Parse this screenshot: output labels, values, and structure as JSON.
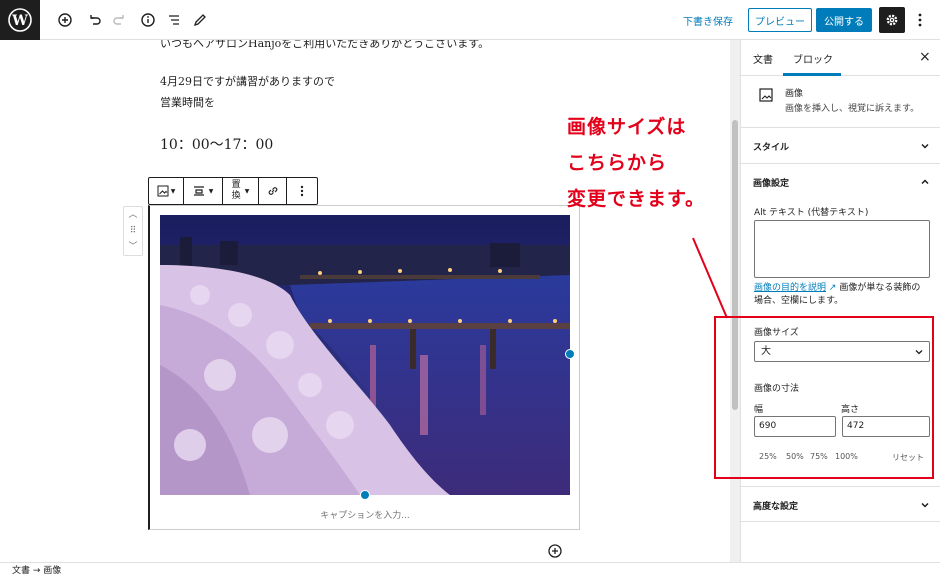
{
  "topbar": {
    "draft_save": "下書き保存",
    "preview": "プレビュー",
    "publish": "公開する",
    "icons": [
      "wordpress-logo",
      "add-block-icon",
      "undo-icon",
      "redo-icon",
      "info-icon",
      "list-view-icon",
      "edit-tool-icon",
      "settings-gear-icon",
      "more-options-icon"
    ]
  },
  "content": {
    "partial_line": "いつもヘアサロンHanjoをご利用いただきありがとうございます。",
    "notice_line": "4月29日ですが講習がありますので",
    "hours_label": "営業時間を",
    "hours": "10：00〜17：00",
    "caption_placeholder": "キャプションを入力..."
  },
  "block_toolbar": {
    "replace_line1": "置",
    "replace_line2": "換"
  },
  "annotation": {
    "line1": "画像サイズは",
    "line2": "こちらから",
    "line3": "変更できます。"
  },
  "sidebar": {
    "tab_document": "文書",
    "tab_block": "ブロック",
    "close": "×",
    "block_name": "画像",
    "block_desc": "画像を挿入し、視覚に訴えます。",
    "style_panel": "スタイル",
    "image_settings_panel": "画像設定",
    "alt_label": "Alt テキスト (代替テキスト)",
    "alt_value": "",
    "help_link": "画像の目的を説明",
    "help_rest_1": "画像が単なる装飾の",
    "help_rest_2": "場合、空欄にします。",
    "size_label": "画像サイズ",
    "size_value": "大",
    "dimensions_label": "画像の寸法",
    "width_label": "幅",
    "height_label": "高さ",
    "width_value": "690",
    "height_value": "472",
    "presets": [
      "25%",
      "50%",
      "75%",
      "100%"
    ],
    "reset": "リセット",
    "advanced_panel": "高度な設定"
  },
  "footer": {
    "breadcrumb": "文書 → 画像"
  },
  "colors": {
    "accent": "#007cba",
    "annotation": "#e2001a",
    "dark": "#1e1e1e"
  }
}
